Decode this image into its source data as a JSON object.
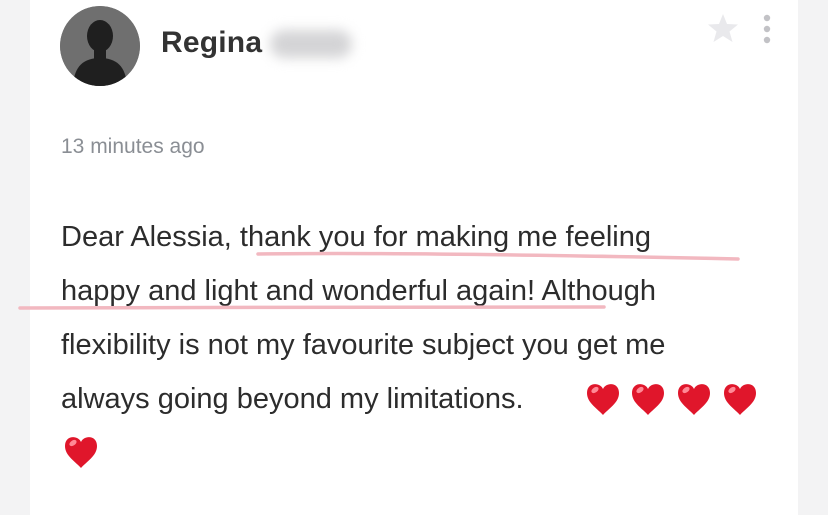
{
  "review": {
    "author_first_name": "Regina",
    "timestamp": "13 minutes ago",
    "text": "Dear Alessia, thank you for making me feeling happy and light and wonderful again! Although flexibility is not my favourite subject you get me always going beyond my limitations.",
    "lines": [
      "Dear Alessia, thank you for making me feeling",
      "happy and light and wonderful again! Although",
      "flexibility is not my favourite subject you get me",
      "always going beyond my limitations."
    ],
    "emoji_hearts": 5
  },
  "icons": {
    "avatar": "person-silhouette-icon",
    "star": "star-icon",
    "more": "more-vertical-icon",
    "heart": "red-heart-emoji"
  },
  "colors": {
    "heart": "#e0162b",
    "underline": "#f2b8c0",
    "timestamp": "#8a8e94",
    "text": "#2c2c2c"
  }
}
